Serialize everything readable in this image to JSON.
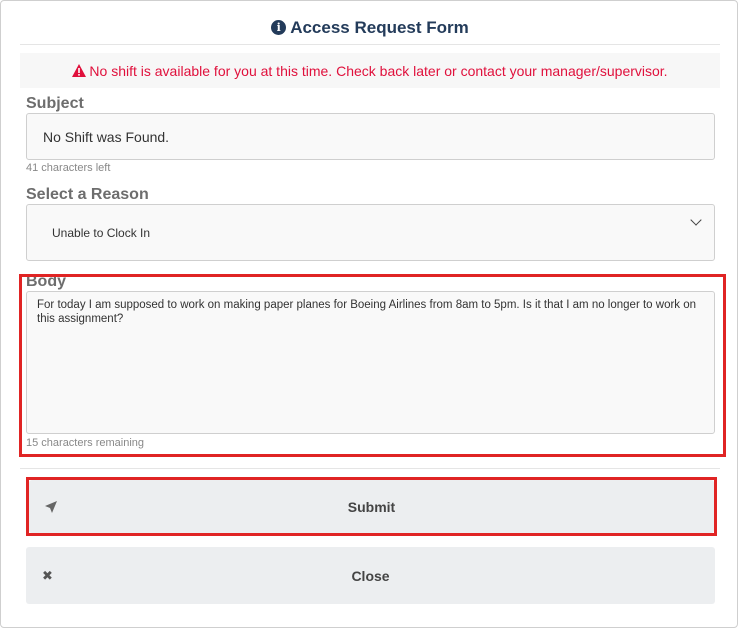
{
  "header": {
    "title": "Access Request Form",
    "icon": "info-circle-icon"
  },
  "alert": {
    "icon": "warning-triangle-icon",
    "text": "No shift is available for you at this time. Check back later or contact your manager/supervisor.",
    "color": "#e0103c"
  },
  "subject": {
    "label": "Subject",
    "value": "No Shift was Found.",
    "counter": "41 characters left"
  },
  "reason": {
    "label": "Select a Reason",
    "value": "Unable to Clock In"
  },
  "body": {
    "label": "Body",
    "value": "For today I am supposed to work on making paper planes for Boeing Airlines from 8am to 5pm. Is it that I am no longer to work on this assignment?",
    "counter": "15 characters remaining"
  },
  "buttons": {
    "submit": {
      "label": "Submit",
      "icon": "paper-plane-icon"
    },
    "close": {
      "label": "Close",
      "icon": "close-x-icon"
    }
  },
  "colors": {
    "title": "#233b5a",
    "highlight": "#e02424",
    "button_bg": "#eceef0"
  }
}
